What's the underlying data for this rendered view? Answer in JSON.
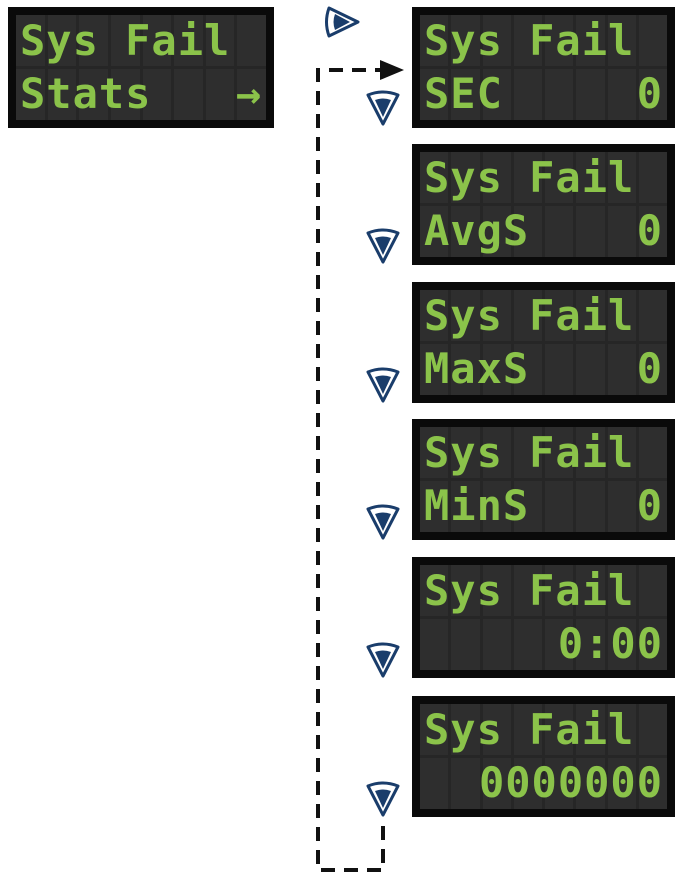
{
  "main_display": {
    "line1": "Sys Fail",
    "line2_left": "Stats",
    "line2_right": "→"
  },
  "screens": [
    {
      "line1": "Sys Fail",
      "line2_left": "SEC",
      "line2_right": "0"
    },
    {
      "line1": "Sys Fail",
      "line2_left": "AvgS",
      "line2_right": "0"
    },
    {
      "line1": "Sys Fail",
      "line2_left": "MaxS",
      "line2_right": "0"
    },
    {
      "line1": "Sys Fail",
      "line2_left": "MinS",
      "line2_right": "0"
    },
    {
      "line1": "Sys Fail",
      "line2_left": "",
      "line2_right": "0:00"
    },
    {
      "line1": "Sys Fail",
      "line2_left": "",
      "line2_right": "0000000"
    }
  ],
  "colors": {
    "lcd_text": "#8bc34a",
    "lcd_bg": "#262626",
    "bezel": "#0a0a0a",
    "button": "#1a3d6b"
  },
  "icons": {
    "enter": "right-arrow-button-icon",
    "next": "down-arrow-button-icon"
  }
}
